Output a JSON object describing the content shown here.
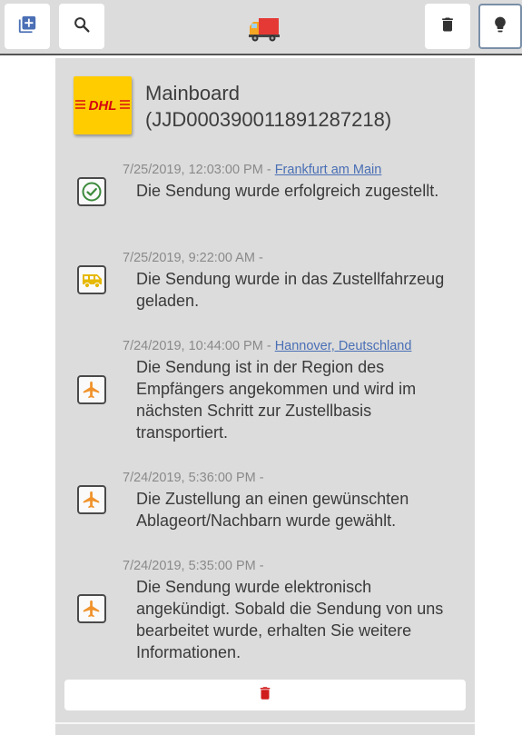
{
  "toolbar": {
    "add_icon": "add-box-icon",
    "search_icon": "search-icon",
    "truck_icon": "delivery-truck-icon",
    "delete_icon": "trash-icon",
    "hint_icon": "lightbulb-icon"
  },
  "package": {
    "title": "Mainboard (JJD000390011891287218)",
    "carrier_logo_text": "DHL",
    "carrier_color": "#ffcc00",
    "carrier_text_color": "#d40511"
  },
  "events": [
    {
      "timestamp": "7/25/2019, 12:03:00 PM",
      "separator": " - ",
      "location": "Frankfurt am Main",
      "text": "Die Sendung wurde erfolgreich zugestellt.",
      "icon": "check-circle-icon",
      "icon_color": "#3c8a3c"
    },
    {
      "timestamp": "7/25/2019, 9:22:00 AM",
      "separator": " -",
      "location": "",
      "text": "Die Sendung wurde in das Zustellfahrzeug geladen.",
      "icon": "van-icon",
      "icon_color": "#e6b800"
    },
    {
      "timestamp": "7/24/2019, 10:44:00 PM",
      "separator": " - ",
      "location": "Hannover, Deutschland",
      "text": "Die Sendung ist in der Region des Empfängers angekommen und wird im nächsten Schritt zur Zustellbasis transportiert.",
      "icon": "airplane-icon",
      "icon_color": "#f0922b"
    },
    {
      "timestamp": "7/24/2019, 5:36:00 PM",
      "separator": " -",
      "location": "",
      "text": "Die Zustellung an einen gewünschten Ablageort/Nachbarn wurde gewählt.",
      "icon": "airplane-icon",
      "icon_color": "#f0922b"
    },
    {
      "timestamp": "7/24/2019, 5:35:00 PM",
      "separator": " -",
      "location": "",
      "text": "Die Sendung wurde elektronisch angekündigt. Sobald die Sendung von uns bearbeitet wurde, erhalten Sie weitere Informationen.",
      "icon": "airplane-icon",
      "icon_color": "#f0922b"
    }
  ],
  "delete_button": {
    "icon": "trash-icon",
    "color": "#d01c1c"
  }
}
